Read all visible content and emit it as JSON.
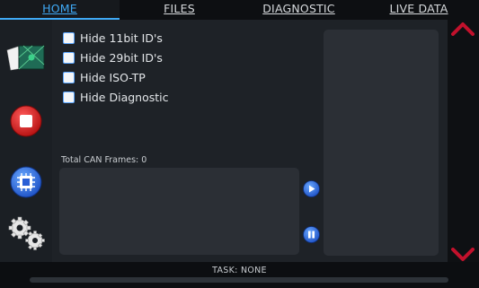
{
  "tabs": [
    {
      "label": "HOME",
      "active": true
    },
    {
      "label": "FILES",
      "active": false
    },
    {
      "label": "DIAGNOSTIC",
      "active": false
    },
    {
      "label": "LIVE DATA",
      "active": false
    }
  ],
  "sidebar": {
    "icons": [
      "load-file-icon",
      "stop-icon",
      "chip-icon",
      "settings-gears-icon"
    ]
  },
  "filters": [
    {
      "label": "Hide 11bit ID's",
      "checked": false
    },
    {
      "label": "Hide 29bit ID's",
      "checked": false
    },
    {
      "label": "Hide ISO-TP",
      "checked": false
    },
    {
      "label": "Hide Diagnostic",
      "checked": false
    }
  ],
  "frames": {
    "label": "Total CAN Frames: 0"
  },
  "status": {
    "text": "TASK: NONE"
  },
  "colors": {
    "accent": "#3fa9f5",
    "stop": "#d11f1f",
    "scroll_arrow": "#c2112c",
    "panel": "#2b2f35"
  }
}
